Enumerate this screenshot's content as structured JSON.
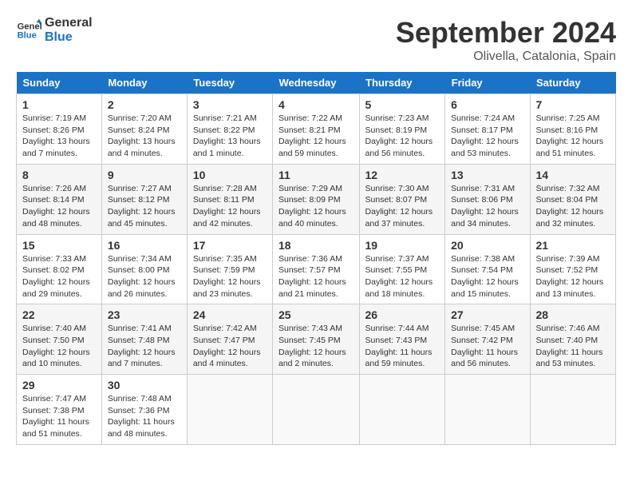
{
  "header": {
    "logo_line1": "General",
    "logo_line2": "Blue",
    "month_title": "September 2024",
    "location": "Olivella, Catalonia, Spain"
  },
  "weekdays": [
    "Sunday",
    "Monday",
    "Tuesday",
    "Wednesday",
    "Thursday",
    "Friday",
    "Saturday"
  ],
  "weeks": [
    [
      {
        "day": "1",
        "info": "Sunrise: 7:19 AM\nSunset: 8:26 PM\nDaylight: 13 hours\nand 7 minutes."
      },
      {
        "day": "2",
        "info": "Sunrise: 7:20 AM\nSunset: 8:24 PM\nDaylight: 13 hours\nand 4 minutes."
      },
      {
        "day": "3",
        "info": "Sunrise: 7:21 AM\nSunset: 8:22 PM\nDaylight: 13 hours\nand 1 minute."
      },
      {
        "day": "4",
        "info": "Sunrise: 7:22 AM\nSunset: 8:21 PM\nDaylight: 12 hours\nand 59 minutes."
      },
      {
        "day": "5",
        "info": "Sunrise: 7:23 AM\nSunset: 8:19 PM\nDaylight: 12 hours\nand 56 minutes."
      },
      {
        "day": "6",
        "info": "Sunrise: 7:24 AM\nSunset: 8:17 PM\nDaylight: 12 hours\nand 53 minutes."
      },
      {
        "day": "7",
        "info": "Sunrise: 7:25 AM\nSunset: 8:16 PM\nDaylight: 12 hours\nand 51 minutes."
      }
    ],
    [
      {
        "day": "8",
        "info": "Sunrise: 7:26 AM\nSunset: 8:14 PM\nDaylight: 12 hours\nand 48 minutes."
      },
      {
        "day": "9",
        "info": "Sunrise: 7:27 AM\nSunset: 8:12 PM\nDaylight: 12 hours\nand 45 minutes."
      },
      {
        "day": "10",
        "info": "Sunrise: 7:28 AM\nSunset: 8:11 PM\nDaylight: 12 hours\nand 42 minutes."
      },
      {
        "day": "11",
        "info": "Sunrise: 7:29 AM\nSunset: 8:09 PM\nDaylight: 12 hours\nand 40 minutes."
      },
      {
        "day": "12",
        "info": "Sunrise: 7:30 AM\nSunset: 8:07 PM\nDaylight: 12 hours\nand 37 minutes."
      },
      {
        "day": "13",
        "info": "Sunrise: 7:31 AM\nSunset: 8:06 PM\nDaylight: 12 hours\nand 34 minutes."
      },
      {
        "day": "14",
        "info": "Sunrise: 7:32 AM\nSunset: 8:04 PM\nDaylight: 12 hours\nand 32 minutes."
      }
    ],
    [
      {
        "day": "15",
        "info": "Sunrise: 7:33 AM\nSunset: 8:02 PM\nDaylight: 12 hours\nand 29 minutes."
      },
      {
        "day": "16",
        "info": "Sunrise: 7:34 AM\nSunset: 8:00 PM\nDaylight: 12 hours\nand 26 minutes."
      },
      {
        "day": "17",
        "info": "Sunrise: 7:35 AM\nSunset: 7:59 PM\nDaylight: 12 hours\nand 23 minutes."
      },
      {
        "day": "18",
        "info": "Sunrise: 7:36 AM\nSunset: 7:57 PM\nDaylight: 12 hours\nand 21 minutes."
      },
      {
        "day": "19",
        "info": "Sunrise: 7:37 AM\nSunset: 7:55 PM\nDaylight: 12 hours\nand 18 minutes."
      },
      {
        "day": "20",
        "info": "Sunrise: 7:38 AM\nSunset: 7:54 PM\nDaylight: 12 hours\nand 15 minutes."
      },
      {
        "day": "21",
        "info": "Sunrise: 7:39 AM\nSunset: 7:52 PM\nDaylight: 12 hours\nand 13 minutes."
      }
    ],
    [
      {
        "day": "22",
        "info": "Sunrise: 7:40 AM\nSunset: 7:50 PM\nDaylight: 12 hours\nand 10 minutes."
      },
      {
        "day": "23",
        "info": "Sunrise: 7:41 AM\nSunset: 7:48 PM\nDaylight: 12 hours\nand 7 minutes."
      },
      {
        "day": "24",
        "info": "Sunrise: 7:42 AM\nSunset: 7:47 PM\nDaylight: 12 hours\nand 4 minutes."
      },
      {
        "day": "25",
        "info": "Sunrise: 7:43 AM\nSunset: 7:45 PM\nDaylight: 12 hours\nand 2 minutes."
      },
      {
        "day": "26",
        "info": "Sunrise: 7:44 AM\nSunset: 7:43 PM\nDaylight: 11 hours\nand 59 minutes."
      },
      {
        "day": "27",
        "info": "Sunrise: 7:45 AM\nSunset: 7:42 PM\nDaylight: 11 hours\nand 56 minutes."
      },
      {
        "day": "28",
        "info": "Sunrise: 7:46 AM\nSunset: 7:40 PM\nDaylight: 11 hours\nand 53 minutes."
      }
    ],
    [
      {
        "day": "29",
        "info": "Sunrise: 7:47 AM\nSunset: 7:38 PM\nDaylight: 11 hours\nand 51 minutes."
      },
      {
        "day": "30",
        "info": "Sunrise: 7:48 AM\nSunset: 7:36 PM\nDaylight: 11 hours\nand 48 minutes."
      },
      {
        "day": "",
        "info": ""
      },
      {
        "day": "",
        "info": ""
      },
      {
        "day": "",
        "info": ""
      },
      {
        "day": "",
        "info": ""
      },
      {
        "day": "",
        "info": ""
      }
    ]
  ]
}
